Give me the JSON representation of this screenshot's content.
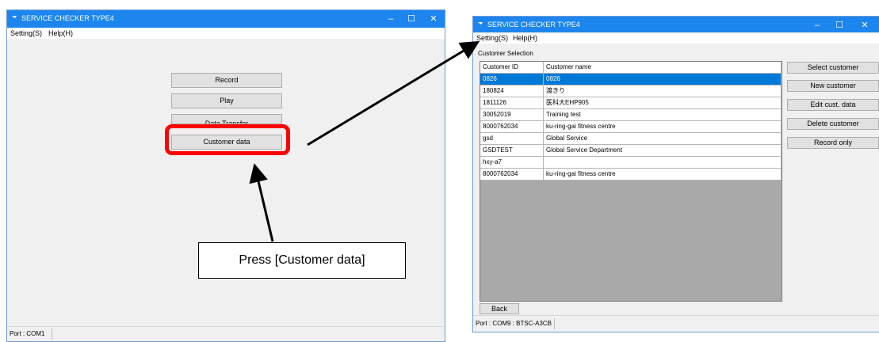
{
  "left_window": {
    "title": "SERVICE CHECKER TYPE4",
    "controls": {
      "minimize": "–",
      "maximize": "☐",
      "close": "✕"
    },
    "menu": [
      "Setting(S)",
      "Help(H)"
    ],
    "buttons": {
      "record": "Record",
      "play": "Play",
      "data_transfer": "Data Transfer",
      "customer_data": "Customer data"
    },
    "status": "Port : COM1"
  },
  "callout": {
    "text": "Press [Customer data]"
  },
  "right_window": {
    "title": "SERVICE CHECKER TYPE4",
    "controls": {
      "minimize": "–",
      "maximize": "☐",
      "close": "✕"
    },
    "menu": [
      "Setting(S)",
      "Help(H)"
    ],
    "section_label": "Customer Selection",
    "table": {
      "headers": [
        "Customer ID",
        "Customer name"
      ],
      "rows": [
        [
          "0826",
          "0826"
        ],
        [
          "180824",
          "渡きり"
        ],
        [
          "1811126",
          "医科大EHP905"
        ],
        [
          "30052019",
          "Training test"
        ],
        [
          "8000762034",
          "ku-ring-gai fitness centre"
        ],
        [
          "gsd",
          "Global Service"
        ],
        [
          "GSDTEST",
          "Global Service Department"
        ],
        [
          "hxy-a7",
          ""
        ],
        [
          "8000762034",
          "ku-ring-gai fitness centre"
        ]
      ],
      "selected_row": 0
    },
    "buttons": {
      "select_customer": "Select customer",
      "new_customer": "New customer",
      "edit_cust_data": "Edit cust. data",
      "delete_customer": "Delete customer",
      "record_only": "Record only",
      "back": "Back"
    },
    "status": "Port : COM9 : BTSC-A3CB"
  },
  "colors": {
    "titlebar": "#1c86ee",
    "highlight": "#ff0000",
    "selection": "#0078d7"
  }
}
